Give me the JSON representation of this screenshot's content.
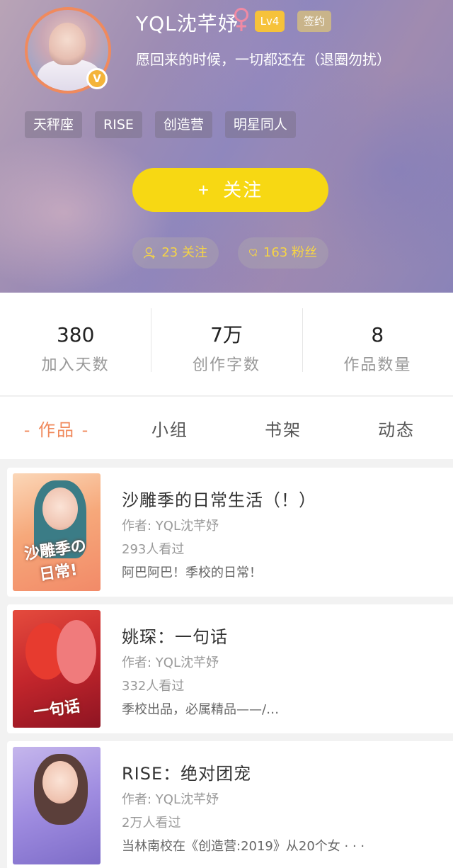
{
  "profile": {
    "username": "YQL沈芊妤",
    "level": "Lv4",
    "sign_label": "签约",
    "verify_mark": "V",
    "bio": "愿回来的时候，一切都还在（退圈勿扰）",
    "tags": [
      "天秤座",
      "RISE",
      "创造营",
      "明星同人"
    ],
    "follow_plus": "+",
    "follow_label": "关注",
    "following_text": "23 关注",
    "fans_text": "163 粉丝",
    "gender_icon": "female-icon",
    "accent_color": "#f08a5d",
    "follow_btn_color": "#f7d813"
  },
  "stats": [
    {
      "value": "380",
      "label": "加入天数"
    },
    {
      "value": "7万",
      "label": "创作字数"
    },
    {
      "value": "8",
      "label": "作品数量"
    }
  ],
  "tabs": [
    {
      "label": "- 作品 -",
      "active": true
    },
    {
      "label": "小组",
      "active": false
    },
    {
      "label": "书架",
      "active": false
    },
    {
      "label": "动态",
      "active": false
    }
  ],
  "works": [
    {
      "title": "沙雕季的日常生活（！）",
      "author": "作者: YQL沈芊妤",
      "views": "293人看过",
      "desc": "阿巴阿巴！季校的日常！",
      "cover_text": "沙雕季の日常!"
    },
    {
      "title": "姚琛：一句话",
      "author": "作者: YQL沈芊妤",
      "views": "332人看过",
      "desc": "季校出品，必属精品——/…",
      "cover_text": "一句话"
    },
    {
      "title": "RISE：绝对团宠",
      "author": "作者: YQL沈芊妤",
      "views": "2万人看过",
      "desc": "当林南校在《创造营:2019》从20个女 · · ·",
      "cover_text": ""
    }
  ]
}
